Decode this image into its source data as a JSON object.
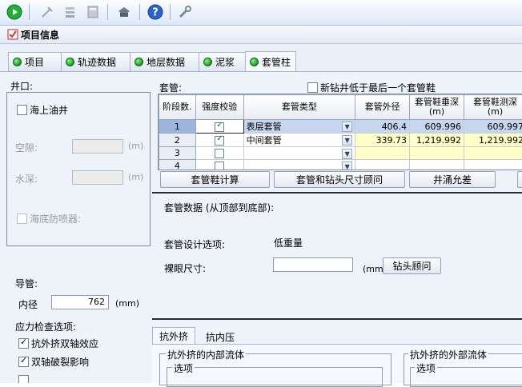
{
  "toolbar": {
    "icons": [
      "run-icon",
      "pick-icon",
      "layers-icon",
      "calculator-icon",
      "install-icon",
      "help-icon",
      "tools-icon"
    ]
  },
  "window": {
    "title": "项目信息"
  },
  "tabs": [
    {
      "label": "项目"
    },
    {
      "label": "轨迹数据"
    },
    {
      "label": "地层数据"
    },
    {
      "label": "泥浆"
    },
    {
      "label": "套管柱",
      "active": true
    }
  ],
  "wellhead": {
    "title": "井口:",
    "offshore_label": "海上油井",
    "gap_label": "空隙:",
    "gap_unit": "(m)",
    "water_depth_label": "水深:",
    "water_depth_unit": "(m)",
    "bop_label": "海底防喷器:"
  },
  "conductor": {
    "title": "导管:",
    "id_label": "内径",
    "id_value": "762",
    "id_unit": "(mm)"
  },
  "stress_options": {
    "title": "应力检查选项:",
    "items": [
      {
        "label": "抗外挤双轴效应",
        "checked": true
      },
      {
        "label": "双轴破裂影响",
        "checked": true
      }
    ]
  },
  "casing": {
    "title": "套管:",
    "new_shoe_label": "新钻井低于最后一个套管鞋",
    "columns": [
      "阶段数.",
      "强度校验",
      "套管类型",
      "套管外径",
      "套管鞋垂深 (m)",
      "套管鞋测深 (m)"
    ],
    "rows": [
      {
        "stage": "1",
        "check": true,
        "type": "表层套管",
        "od": "406.4",
        "tvd": "609.996",
        "md": "609.997"
      },
      {
        "stage": "2",
        "check": true,
        "type": "中间套管",
        "od": "339.73",
        "tvd": "1,219.992",
        "md": "1,219.992"
      },
      {
        "stage": "3",
        "check": false,
        "type": "",
        "od": "",
        "tvd": "",
        "md": ""
      },
      {
        "stage": "4",
        "check": false,
        "type": "",
        "od": "",
        "tvd": "",
        "md": ""
      }
    ],
    "buttons": [
      "套管鞋计算",
      "套管和钻头尺寸顾问",
      "井涌允差"
    ]
  },
  "casing_data": {
    "title": "套管数据 (从顶部到底部):",
    "design_option_label": "套管设计选项:",
    "design_option_value": "低重量",
    "open_hole_label": "裸眼尺寸:",
    "open_hole_unit": "(mm)",
    "bit_advisor_button": "钻头顾问"
  },
  "bottom_tabs": [
    {
      "label": "抗外挤",
      "active": true
    },
    {
      "label": "抗内压"
    }
  ],
  "collapse": {
    "internal_title": "抗外挤的内部流体",
    "internal_option": "选项",
    "external_title": "抗外挤的外部流体",
    "external_option": "选项"
  }
}
